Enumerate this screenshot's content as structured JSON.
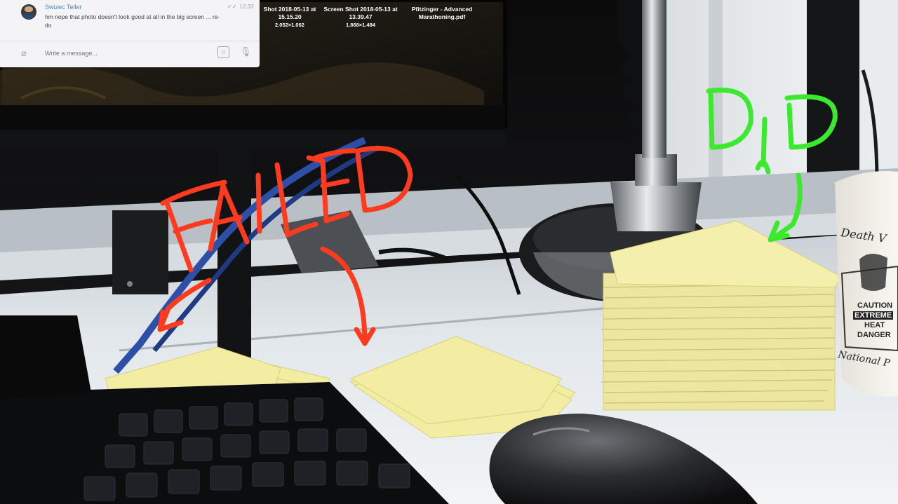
{
  "chat": {
    "sender": "Swizec Teller",
    "message": "hm nope that photo doesn't look good at all in the big screen ... re-do",
    "time": "12:33",
    "input_placeholder": "Write a message..."
  },
  "desktop_files": [
    {
      "name": "Shot 2018-05-13 at 15.15.20",
      "name_line1": "Shot 2018-05-13 at",
      "name_line2": "15.15.20",
      "size": "2.052×1.062"
    },
    {
      "name": "Screen Shot 2018-05-13 at 13.39.47",
      "name_line1": "Screen Shot 2018-05-13 at",
      "name_line2": "13.39.47",
      "size": "1.868×1.484"
    },
    {
      "name": "Pfitzinger - Advanced Marathoning.pdf",
      "name_line1": "Pfitzinger - Advanced",
      "name_line2": "Marathoning.pdf",
      "size": ""
    }
  ],
  "annotations": {
    "failed": "FAILED",
    "did": "DID"
  },
  "mug": {
    "line1": "Death V",
    "caution": "CAUTION",
    "extreme": "EXTREME",
    "heat": "HEAT",
    "danger": "DANGER",
    "footer": "National P"
  },
  "colors": {
    "failed_red": "#ff3b1f",
    "did_green": "#3bea2c",
    "sticky_yellow": "#f3eda4",
    "desk_white": "#e6ecef"
  }
}
